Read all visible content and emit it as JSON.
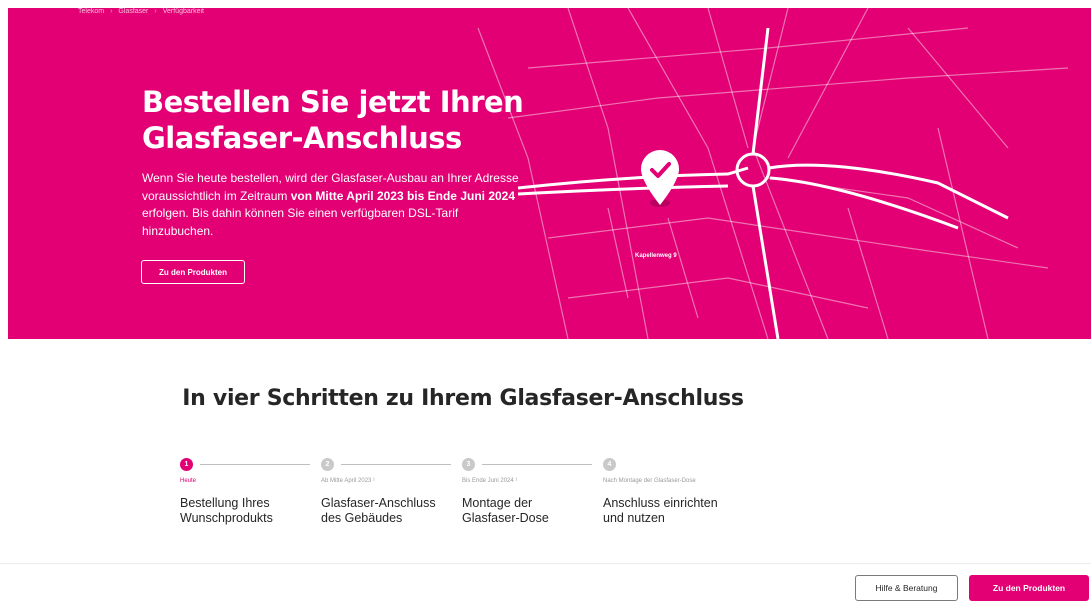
{
  "breadcrumb": [
    "Telekom",
    "Glasfaser",
    "Verfügbarkeit"
  ],
  "hero": {
    "title_line1": "Bestellen Sie jetzt Ihren",
    "title_line2": "Glasfaser-Anschluss",
    "intro_part1": "Wenn Sie heute bestellen, wird der Glasfaser-Ausbau an Ihrer Adresse voraussichtlich im Zeitraum ",
    "intro_bold": "von Mitte April 2023 bis Ende Juni 2024",
    "intro_part2": " erfolgen. Bis dahin können Sie einen verfügbaren DSL-Tarif hinzubuchen.",
    "button_label": "Zu den Produkten",
    "map_address": "Kapellenweg 9",
    "accent_color": "#e20074"
  },
  "steps_section": {
    "title": "In vier Schritten zu Ihrem Glasfaser-Anschluss",
    "steps": [
      {
        "number": "1",
        "date": "Heute",
        "desc_line1": "Bestellung Ihres",
        "desc_line2": "Wunschprodukts"
      },
      {
        "number": "2",
        "date": "Ab Mitte April 2023 ¹",
        "desc_line1": "Glasfaser-Anschluss",
        "desc_line2": "des Gebäudes"
      },
      {
        "number": "3",
        "date": "Bis Ende Juni 2024 ¹",
        "desc_line1": "Montage der",
        "desc_line2": "Glasfaser-Dose"
      },
      {
        "number": "4",
        "date": "Nach Montage der Glasfaser-Dose",
        "desc_line1": "Anschluss einrichten",
        "desc_line2": "und nutzen"
      }
    ]
  },
  "bottom_bar": {
    "help_label": "Hilfe & Beratung",
    "products_label": "Zu den Produkten"
  }
}
